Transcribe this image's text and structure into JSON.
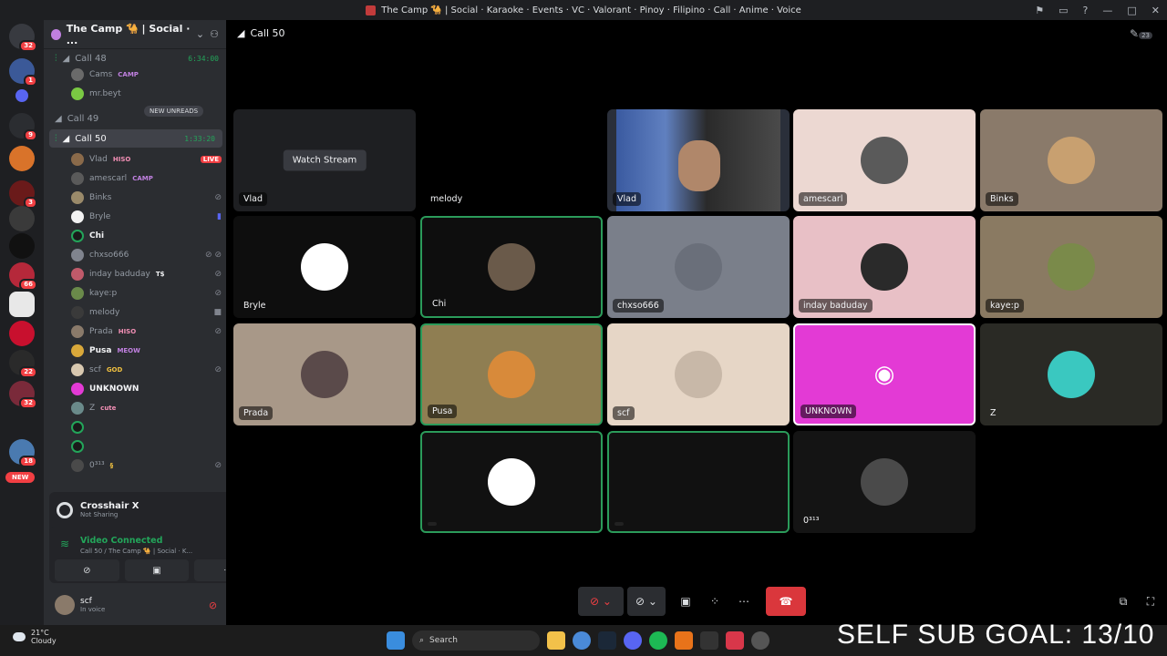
{
  "window": {
    "title": "The Camp 🐪 | Social · Karaoke · Events · VC · Valorant · Pinoy · Filipino · Call · Anime · Voice"
  },
  "guild_badges": [
    "32",
    "1",
    "9",
    "3",
    "66",
    "22",
    "32",
    "18"
  ],
  "guild_new": "NEW",
  "server": {
    "name": "The Camp 🐪 | Social · ..."
  },
  "new_unreads": "NEW UNREADS",
  "channels": [
    {
      "name": "Call 48",
      "timer": "6:34:00",
      "active": false
    },
    {
      "name": "Call 49",
      "timer": "",
      "active": false
    },
    {
      "name": "Call 50",
      "timer": "1:33:20",
      "active": true
    }
  ],
  "call48_members": [
    {
      "name": "Cams",
      "tag": "CAMP"
    },
    {
      "name": "mr.beyt",
      "tag": ""
    }
  ],
  "call50_members": [
    {
      "name": "Vlad",
      "tag": "HISO",
      "status": "LIVE"
    },
    {
      "name": "amescarl",
      "tag": "CAMP"
    },
    {
      "name": "Binks",
      "tag": ""
    },
    {
      "name": "Bryle",
      "tag": ""
    },
    {
      "name": "Chi",
      "tag": ""
    },
    {
      "name": "chxso666",
      "tag": ""
    },
    {
      "name": "inday baduday",
      "tag": "T$"
    },
    {
      "name": "kaye:p",
      "tag": ""
    },
    {
      "name": "melody",
      "tag": ""
    },
    {
      "name": "Prada",
      "tag": "HISO"
    },
    {
      "name": "Pusa",
      "tag": "MEOW"
    },
    {
      "name": "scf",
      "tag": "GOD"
    },
    {
      "name": "UNKNOWN",
      "tag": ""
    },
    {
      "name": "Z",
      "tag": "cute"
    },
    {
      "name": "",
      "tag": ""
    },
    {
      "name": "",
      "tag": ""
    },
    {
      "name": "0³¹³",
      "tag": "§"
    }
  ],
  "activity": {
    "title": "Crosshair X",
    "subtitle": "Not Sharing"
  },
  "voice": {
    "status": "Video Connected",
    "location": "Call 50 / The Camp 🐪 | Social · K..."
  },
  "user": {
    "name": "scf",
    "status": "In voice"
  },
  "stage": {
    "channel": "Call 50",
    "header_badge": "23",
    "watch_label": "Watch Stream",
    "tiles": [
      {
        "name": "Vlad",
        "kind": "stream"
      },
      {
        "name": "melody",
        "kind": "empty"
      },
      {
        "name": "Vlad",
        "kind": "camera"
      },
      {
        "name": "amescarl",
        "kind": "avatar"
      },
      {
        "name": "Binks",
        "kind": "avatar"
      },
      {
        "name": "Bryle",
        "kind": "avatar"
      },
      {
        "name": "Chi",
        "kind": "avatar"
      },
      {
        "name": "chxso666",
        "kind": "avatar"
      },
      {
        "name": "inday baduday",
        "kind": "avatar"
      },
      {
        "name": "kaye:p",
        "kind": "avatar"
      },
      {
        "name": "Prada",
        "kind": "avatar"
      },
      {
        "name": "Pusa",
        "kind": "avatar"
      },
      {
        "name": "scf",
        "kind": "avatar"
      },
      {
        "name": "UNKNOWN",
        "kind": "avatar"
      },
      {
        "name": "Z",
        "kind": "avatar"
      },
      {
        "name": "",
        "kind": "avatar"
      },
      {
        "name": "",
        "kind": "empty"
      },
      {
        "name": "0³¹³",
        "kind": "avatar"
      }
    ]
  },
  "taskbar": {
    "temp": "21°C",
    "weather": "Cloudy",
    "search": "Search"
  },
  "overlay_text": "SELF SUB GOAL: 13/10",
  "colors": {
    "accent": "#5865f2",
    "online": "#23a55a",
    "danger": "#da373c",
    "unknown_tile": "#e33ad5"
  }
}
